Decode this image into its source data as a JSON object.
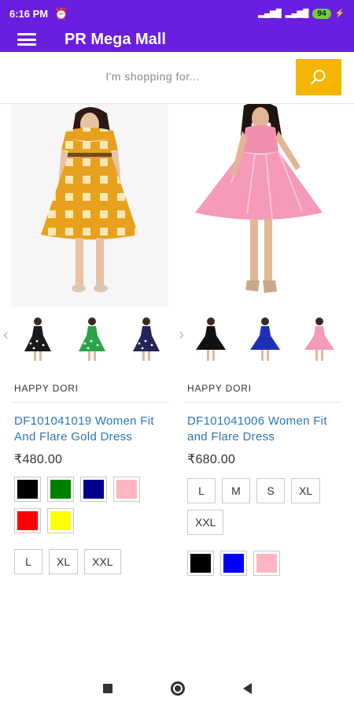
{
  "status_bar": {
    "time": "6:16 PM",
    "battery": "94"
  },
  "app_bar": {
    "title": "PR Mega Mall"
  },
  "search": {
    "placeholder": "I'm shopping for..."
  },
  "products": [
    {
      "brand": "HAPPY DORI",
      "title": "DF101041019 Women Fit And Flare Gold Dress",
      "price": "₹480.00",
      "colors": [
        "#000000",
        "#008000",
        "#00008b",
        "#ffb6c1",
        "#ff0000",
        "#ffff00"
      ],
      "sizes": [
        "L",
        "XL",
        "XXL"
      ],
      "thumbnails": [
        "black-polka-dress-thumb",
        "green-polka-dress-thumb",
        "navy-polka-dress-thumb"
      ]
    },
    {
      "brand": "HAPPY DORI",
      "title": "DF101041006 Women Fit and Flare Dress",
      "price": "₹680.00",
      "sizes": [
        "L",
        "M",
        "S",
        "XL",
        "XXL"
      ],
      "colors": [
        "#000000",
        "#0000ff",
        "#ffb6c1"
      ],
      "thumbnails": [
        "black-dress-thumb",
        "blue-dress-thumb",
        "pink-dress-thumb"
      ]
    }
  ],
  "icons": {
    "menu": "hamburger-icon",
    "search": "search-icon",
    "prev": "chevron-left-icon",
    "next": "chevron-right-icon",
    "alarm": "alarm-icon"
  },
  "colors": {
    "app_bar": "#6a1ee0",
    "search_button": "#f5b500",
    "title_link": "#2b77b8"
  }
}
